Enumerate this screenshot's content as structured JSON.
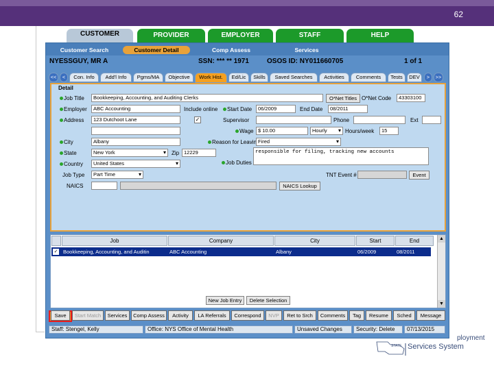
{
  "slide": {
    "page_number": "62"
  },
  "main_tabs": [
    "CUSTOMER",
    "PROVIDER",
    "EMPLOYER",
    "STAFF",
    "HELP"
  ],
  "sub_nav": [
    "Customer Search",
    "Customer Detail",
    "Comp Assess",
    "Services"
  ],
  "header": {
    "name": "NYESSGUY, MR A",
    "ssn": "SSN: *** ** 1971",
    "osos_id": "OSOS ID: NY011660705",
    "record_count": "1 of 1"
  },
  "detail_tabs": [
    "<<",
    "<",
    "Con. Info",
    "Add'l Info",
    "Pgms/MA",
    "Objective",
    "Work Hist.",
    "Ed/Lic",
    "Skills",
    "Saved Searches",
    "Activities",
    "Comments",
    "Tests",
    "DEV",
    ">",
    ">>"
  ],
  "detail": {
    "legend": "Detail",
    "labels": {
      "job_title": "Job Title",
      "employer": "Employer",
      "address": "Address",
      "city": "City",
      "state": "State",
      "zip": "Zip",
      "country": "Country",
      "job_type": "Job Type",
      "naics": "NAICS",
      "include_online": "Include online",
      "start_date": "Start Date",
      "end_date": "End Date",
      "supervisor": "Supervisor",
      "phone": "Phone",
      "ext": "Ext",
      "wage": "Wage",
      "hours_week": "Hours/week",
      "reason_for_leaving": "Reason for Leaving",
      "job_duties": "Job Duties",
      "onet_code": "O*Net Code",
      "tnt_event": "TNT Event #"
    },
    "values": {
      "job_title": "Bookkeeping, Accounting, and Auditing Clerks",
      "employer": "ABC Accounting",
      "address": "123 Dutchoot Lane",
      "city": "Albany",
      "state": "New York",
      "zip": "12229",
      "country": "United States",
      "job_type": "Part Time",
      "start_date": "06/2009",
      "end_date": "08/2011",
      "wage": "$ 10.00",
      "wage_unit": "Hourly",
      "hours_week": "15",
      "reason_for_leaving": "Fired",
      "job_duties": "responsible for filing, tracking new accounts",
      "onet_code": "43303100",
      "include_online_check": "✓"
    },
    "buttons": {
      "onet_titles": "O*Net Titles",
      "naics_lookup": "NAICS Lookup",
      "event": "Event"
    }
  },
  "grid": {
    "columns": [
      "Job",
      "Company",
      "City",
      "Start",
      "End"
    ],
    "rows": [
      {
        "check": "✓",
        "job": "Bookkeeping, Accounting, and Auditin",
        "company": "ABC Accounting",
        "city": "Albany",
        "start": "06/2009",
        "end": "08/2011"
      }
    ],
    "buttons": {
      "new_job_entry": "New Job Entry",
      "delete_selection": "Delete Selection"
    }
  },
  "bottom_buttons": [
    "Save",
    "Start Match",
    "Services",
    "Comp Assess",
    "Activity",
    "LA Referrals",
    "Correspond",
    "NVP",
    "Ret to Srch",
    "Comments",
    "Tag",
    "Resume",
    "Sched",
    "Message"
  ],
  "status_bar": {
    "staff": "Staff: Stengel, Kelly",
    "office": "Office: NYS Office of Mental Health",
    "unsaved": "Unsaved Changes",
    "security": "Security: Delete",
    "date": "07/13/2015"
  },
  "branding": {
    "employment_text": "ployment",
    "system_text": "Services System",
    "state_text": "STATE"
  }
}
